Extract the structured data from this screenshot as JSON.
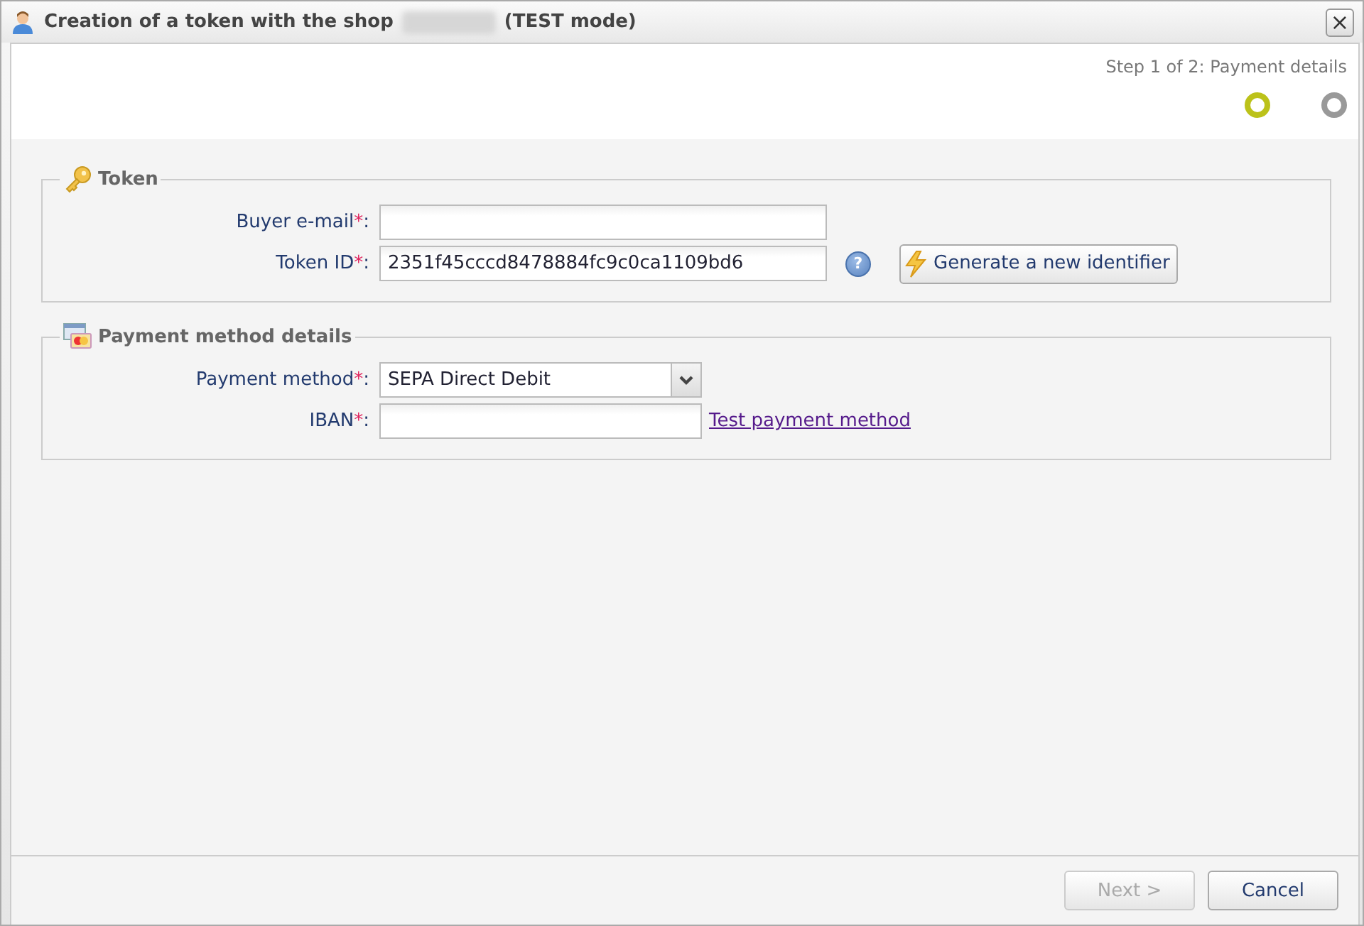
{
  "window": {
    "title_start": "Creation of a token with the shop",
    "title_end": "(TEST mode)",
    "close": "×"
  },
  "steps": {
    "label": "Step 1 of 2: Payment details",
    "items": [
      {
        "selected": true
      },
      {
        "selected": false
      }
    ]
  },
  "sections": [
    {
      "title": "Token",
      "fields": [
        {
          "kind": "text",
          "label": "Buyer e-mail",
          "required_mark": "*",
          "colon": ":"
        },
        {
          "kind": "text",
          "label": "Token ID",
          "required_mark": "*",
          "colon": ":",
          "value": "2351f45cccd8478884fc9c0ca1109bd6",
          "help": "?",
          "button": "Generate a new identifier"
        }
      ]
    },
    {
      "title": "Payment method details",
      "fields": [
        {
          "kind": "select",
          "label": "Payment method",
          "required_mark": "*",
          "colon": ":",
          "value": "SEPA Direct Debit"
        },
        {
          "kind": "short",
          "label": "IBAN",
          "required_mark": "*",
          "colon": ":",
          "link": "Test payment method"
        }
      ]
    }
  ],
  "buttons": [
    {
      "label": "Next >",
      "disabled": true
    },
    {
      "label": "Cancel",
      "disabled": false
    }
  ]
}
